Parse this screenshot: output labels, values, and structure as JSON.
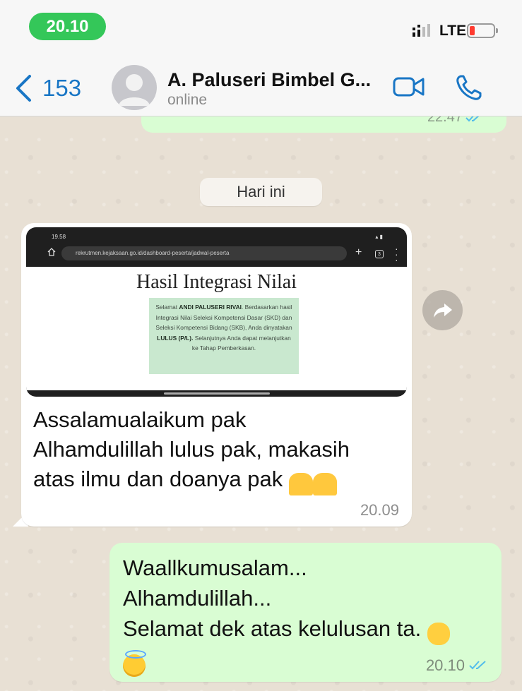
{
  "status_bar": {
    "time": "20.10",
    "network": "LTE"
  },
  "header": {
    "back_count": "153",
    "contact_name": "A. Paluseri Bimbel G...",
    "contact_status": "online"
  },
  "previous_message": {
    "time": "22.47"
  },
  "day_separator": "Hari ini",
  "incoming": {
    "screenshot": {
      "time": "19.58",
      "url": "rekrutmen.kejaksaan.go.id/dashboard-peserta/jadwal-peserta",
      "tab_count": "3",
      "title": "Hasil Integrasi Nilai",
      "greeting": "Selamat",
      "candidate_name": "ANDI PALUSERI RIVAI",
      "body": "Berdasarkan hasil Integrasi Nilai Seleksi Kompetensi Dasar (SKD) dan Seleksi Kompetensi Bidang (SKB), Anda dinyatakan",
      "result": "LULUS (P/L).",
      "closing": "Selanjutnya Anda dapat melanjutkan ke Tahap Pemberkasan."
    },
    "text_line1": "Assalamualaikum pak",
    "text_line2": "Alhamdulillah lulus pak, makasih",
    "text_line3": "atas ilmu dan doanya pak",
    "emojis": [
      "folded-hands",
      "folded-hands"
    ],
    "time": "20.09"
  },
  "outgoing": {
    "line1": "Waallkumusalam...",
    "line2": "Alhamdulillah...",
    "line3": "Selamat dek atas kelulusan ta.",
    "emojis": [
      "raising-hands",
      "smiling-face-with-halo"
    ],
    "time": "20.10",
    "read_receipt": "double-check-blue"
  },
  "colors": {
    "accent_blue": "#1976c5",
    "status_green": "#34c759",
    "outgoing_bubble": "#d9fdd3",
    "incoming_bubble": "#ffffff",
    "read_tick": "#53bdeb"
  }
}
